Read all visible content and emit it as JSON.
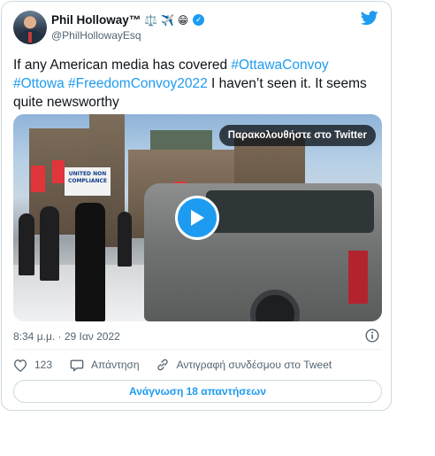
{
  "author": {
    "name": "Phil Holloway™",
    "emojis": "⚖️ ✈️ 😁",
    "handle": "@PhilHollowayEsq"
  },
  "icons": {
    "brand": "twitter-bird-icon",
    "verified": "verified-badge-icon",
    "info": "info-icon",
    "like": "heart-icon",
    "reply": "reply-bubble-icon",
    "copy_link": "link-icon",
    "play": "play-icon"
  },
  "colors": {
    "accent": "#1d9bf0",
    "text": "#0f1419",
    "secondary": "#536471",
    "border": "#cfd9de"
  },
  "tweet": {
    "text_1": "If any American media has covered ",
    "tag_1": "#OttawaConvoy",
    "tag_2": "#Ottowa",
    "tag_3": "#FreedomConvoy2022",
    "text_2": " I haven’t seen it. It seems quite newsworthy"
  },
  "media": {
    "watch_label": "Παρακολουθήστε στο Twitter",
    "sign_text": "UNITED NON COMPLIANCE"
  },
  "meta": {
    "timestamp": "8:34 μ.μ. · 29 Ιαν 2022"
  },
  "actions": {
    "like_count": "123",
    "reply_label": "Απάντηση",
    "copy_link_label": "Αντιγραφή συνδέσμου στο Tweet"
  },
  "footer": {
    "read_replies": "Ανάγνωση 18 απαντήσεων"
  }
}
